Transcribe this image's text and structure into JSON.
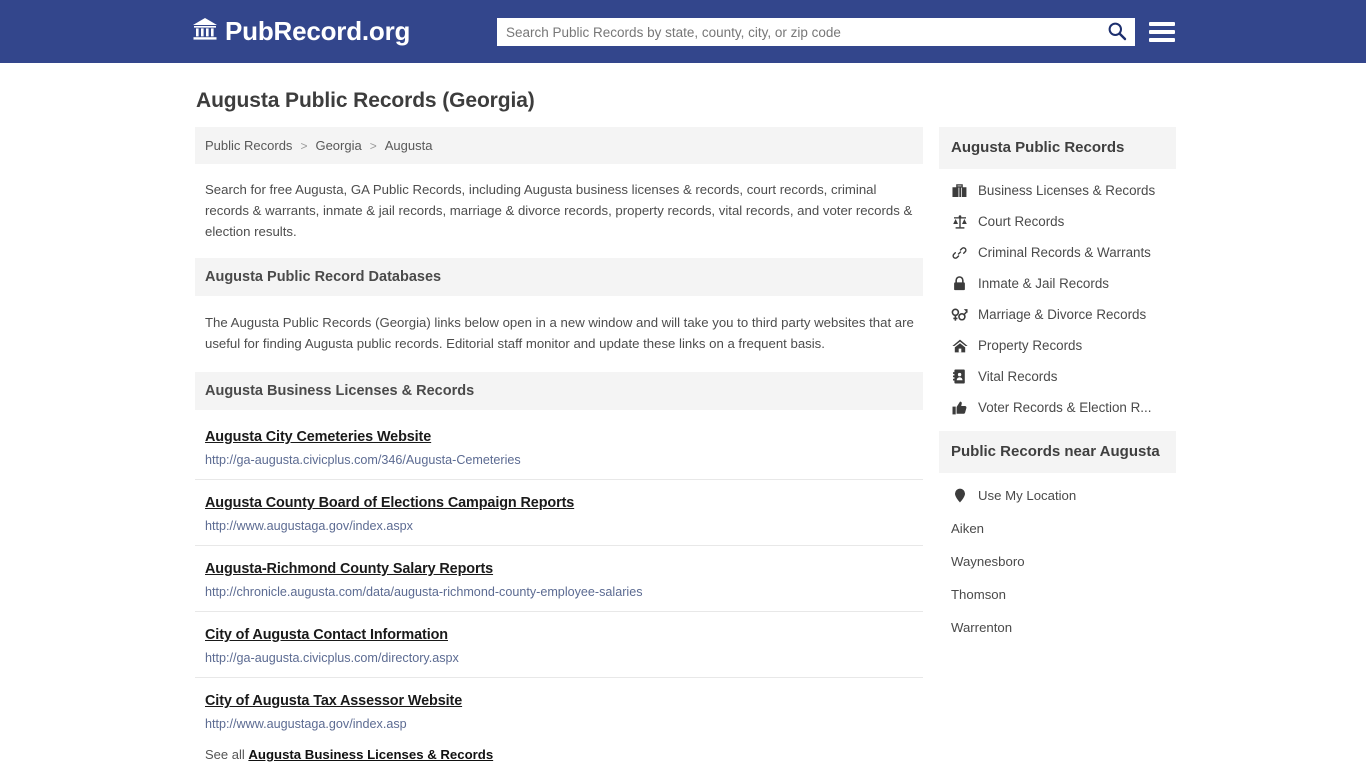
{
  "header": {
    "brand_name": "PubRecord.org",
    "brand_icon": "bank-icon",
    "search": {
      "placeholder": "Search Public Records by state, county, city, or zip code",
      "value": "",
      "search_icon": "search-icon"
    },
    "menu_icon": "hamburger-menu-icon",
    "background_color": "#33468c"
  },
  "page": {
    "title": "Augusta Public Records (Georgia)"
  },
  "breadcrumb": {
    "items": [
      {
        "label": "Public Records"
      },
      {
        "label": "Georgia"
      },
      {
        "label": "Augusta"
      }
    ],
    "separator": ">"
  },
  "intro": {
    "text": "Search for free Augusta, GA Public Records, including Augusta business licenses & records, court records, criminal records & warrants, inmate & jail records, marriage & divorce records, property records, vital records, and voter records & election results."
  },
  "databases_section": {
    "heading": "Augusta Public Record Databases",
    "description": "The Augusta Public Records (Georgia) links below open in a new window and will take you to third party websites that are useful for finding Augusta public records. Editorial staff monitor and update these links on a frequent basis."
  },
  "business_section": {
    "heading": "Augusta Business Licenses & Records",
    "links": [
      {
        "title": "Augusta City Cemeteries Website",
        "url": "http://ga-augusta.civicplus.com/346/Augusta-Cemeteries"
      },
      {
        "title": "Augusta County Board of Elections Campaign Reports",
        "url": "http://www.augustaga.gov/index.aspx"
      },
      {
        "title": "Augusta-Richmond County Salary Reports",
        "url": "http://chronicle.augusta.com/data/augusta-richmond-county-employee-salaries"
      },
      {
        "title": "City of Augusta Contact Information",
        "url": "http://ga-augusta.civicplus.com/directory.aspx"
      },
      {
        "title": "City of Augusta Tax Assessor Website",
        "url": "http://www.augustaga.gov/index.asp"
      }
    ],
    "see_all_prefix": "See all",
    "see_all_link": "Augusta Business Licenses & Records"
  },
  "sidebar": {
    "records_panel": {
      "heading": "Augusta Public Records",
      "items": [
        {
          "label": "Business Licenses & Records",
          "icon": "briefcase-icon"
        },
        {
          "label": "Court Records",
          "icon": "scales-of-justice-icon"
        },
        {
          "label": "Criminal Records & Warrants",
          "icon": "chain-link-icon"
        },
        {
          "label": "Inmate & Jail Records",
          "icon": "lock-icon"
        },
        {
          "label": "Marriage & Divorce Records",
          "icon": "venus-mars-icon"
        },
        {
          "label": "Property Records",
          "icon": "home-icon"
        },
        {
          "label": "Vital Records",
          "icon": "address-book-icon"
        },
        {
          "label": "Voter Records & Election R...",
          "icon": "thumbs-up-icon"
        }
      ]
    },
    "near_panel": {
      "heading": "Public Records near Augusta",
      "use_my_location": {
        "label": "Use My Location",
        "icon": "map-pin-icon"
      },
      "cities": [
        {
          "label": "Aiken"
        },
        {
          "label": "Waynesboro"
        },
        {
          "label": "Thomson"
        },
        {
          "label": "Warrenton"
        }
      ]
    }
  }
}
